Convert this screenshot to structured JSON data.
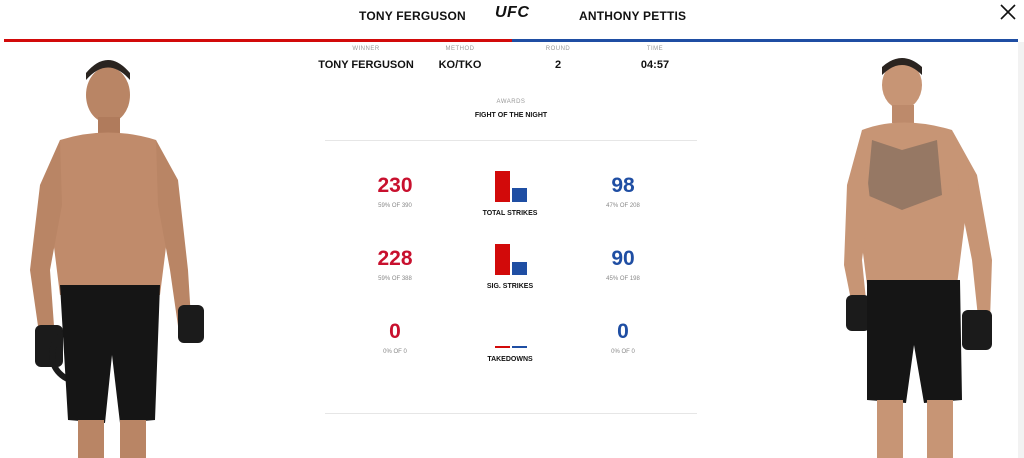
{
  "header": {
    "red_fighter": "TONY FERGUSON",
    "blue_fighter": "ANTHONY PETTIS",
    "logo": "UFC",
    "close_icon": "close-icon"
  },
  "colors": {
    "red": "#d20a0a",
    "blue": "#1f4ea3"
  },
  "summary": {
    "winner_label": "WINNER",
    "winner": "TONY FERGUSON",
    "method_label": "METHOD",
    "method": "KO/TKO",
    "round_label": "ROUND",
    "round": "2",
    "time_label": "TIME",
    "time": "04:57"
  },
  "awards": {
    "label": "AWARDS",
    "value": "FIGHT OF THE NIGHT"
  },
  "stats": [
    {
      "label": "TOTAL STRIKES",
      "red": "230",
      "red_detail": "59% OF 390",
      "blue": "98",
      "blue_detail": "47% OF 208"
    },
    {
      "label": "SIG. STRIKES",
      "red": "228",
      "red_detail": "59% OF 388",
      "blue": "90",
      "blue_detail": "45% OF 198"
    },
    {
      "label": "TAKEDOWNS",
      "red": "0",
      "red_detail": "0% OF 0",
      "blue": "0",
      "blue_detail": "0% OF 0"
    }
  ],
  "figures": {
    "red": "fighter-photo",
    "blue": "fighter-photo"
  }
}
